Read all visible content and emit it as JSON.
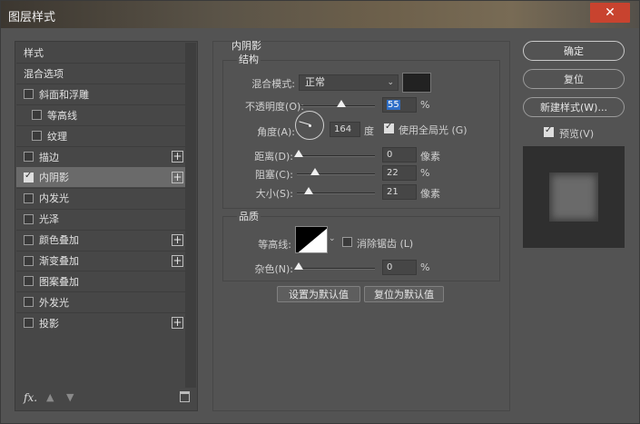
{
  "dialog": {
    "title": "图层样式",
    "close": "✕"
  },
  "styles_list": [
    {
      "label": "样式",
      "checkbox": false,
      "checked": false,
      "plus": false,
      "indent": 0,
      "selected": false
    },
    {
      "label": "混合选项",
      "checkbox": false,
      "checked": false,
      "plus": false,
      "indent": 0,
      "selected": false
    },
    {
      "label": "斜面和浮雕",
      "checkbox": true,
      "checked": false,
      "plus": false,
      "indent": 0,
      "selected": false
    },
    {
      "label": "等高线",
      "checkbox": true,
      "checked": false,
      "plus": false,
      "indent": 1,
      "selected": false
    },
    {
      "label": "纹理",
      "checkbox": true,
      "checked": false,
      "plus": false,
      "indent": 1,
      "selected": false
    },
    {
      "label": "描边",
      "checkbox": true,
      "checked": false,
      "plus": true,
      "indent": 0,
      "selected": false
    },
    {
      "label": "内阴影",
      "checkbox": true,
      "checked": true,
      "plus": true,
      "indent": 0,
      "selected": true
    },
    {
      "label": "内发光",
      "checkbox": true,
      "checked": false,
      "plus": false,
      "indent": 0,
      "selected": false
    },
    {
      "label": "光泽",
      "checkbox": true,
      "checked": false,
      "plus": false,
      "indent": 0,
      "selected": false
    },
    {
      "label": "颜色叠加",
      "checkbox": true,
      "checked": false,
      "plus": true,
      "indent": 0,
      "selected": false
    },
    {
      "label": "渐变叠加",
      "checkbox": true,
      "checked": false,
      "plus": true,
      "indent": 0,
      "selected": false
    },
    {
      "label": "图案叠加",
      "checkbox": true,
      "checked": false,
      "plus": false,
      "indent": 0,
      "selected": false
    },
    {
      "label": "外发光",
      "checkbox": true,
      "checked": false,
      "plus": false,
      "indent": 0,
      "selected": false
    },
    {
      "label": "投影",
      "checkbox": true,
      "checked": false,
      "plus": true,
      "indent": 0,
      "selected": false
    }
  ],
  "list_footer": {
    "fx": "fx",
    "fx_dot": "."
  },
  "inner_shadow": {
    "section_title": "内阴影",
    "structure_title": "结构",
    "blend_mode_label": "混合模式:",
    "blend_mode_value": "正常",
    "shadow_color": "#222222",
    "opacity_label": "不透明度(O):",
    "opacity_value": "55",
    "opacity_unit": "%",
    "angle_label": "角度(A):",
    "angle_value": "164",
    "angle_unit": "度",
    "global_light_label": "使用全局光 (G)",
    "global_light_checked": true,
    "distance_label": "距离(D):",
    "distance_value": "0",
    "distance_unit": "像素",
    "choke_label": "阻塞(C):",
    "choke_value": "22",
    "choke_unit": "%",
    "size_label": "大小(S):",
    "size_value": "21",
    "size_unit": "像素",
    "quality_title": "品质",
    "contour_label": "等高线:",
    "anti_alias_label": "消除锯齿 (L)",
    "anti_alias_checked": false,
    "noise_label": "杂色(N):",
    "noise_value": "0",
    "noise_unit": "%",
    "set_default_label": "设置为默认值",
    "reset_default_label": "复位为默认值"
  },
  "slider_levels": {
    "opacity": 0.55,
    "distance": 0.0,
    "choke": 0.22,
    "size": 0.14,
    "noise": 0.0
  },
  "buttons": {
    "ok": "确定",
    "reset": "复位",
    "new_style": "新建样式(W)...",
    "preview_label": "预览(V)",
    "preview_checked": true
  }
}
